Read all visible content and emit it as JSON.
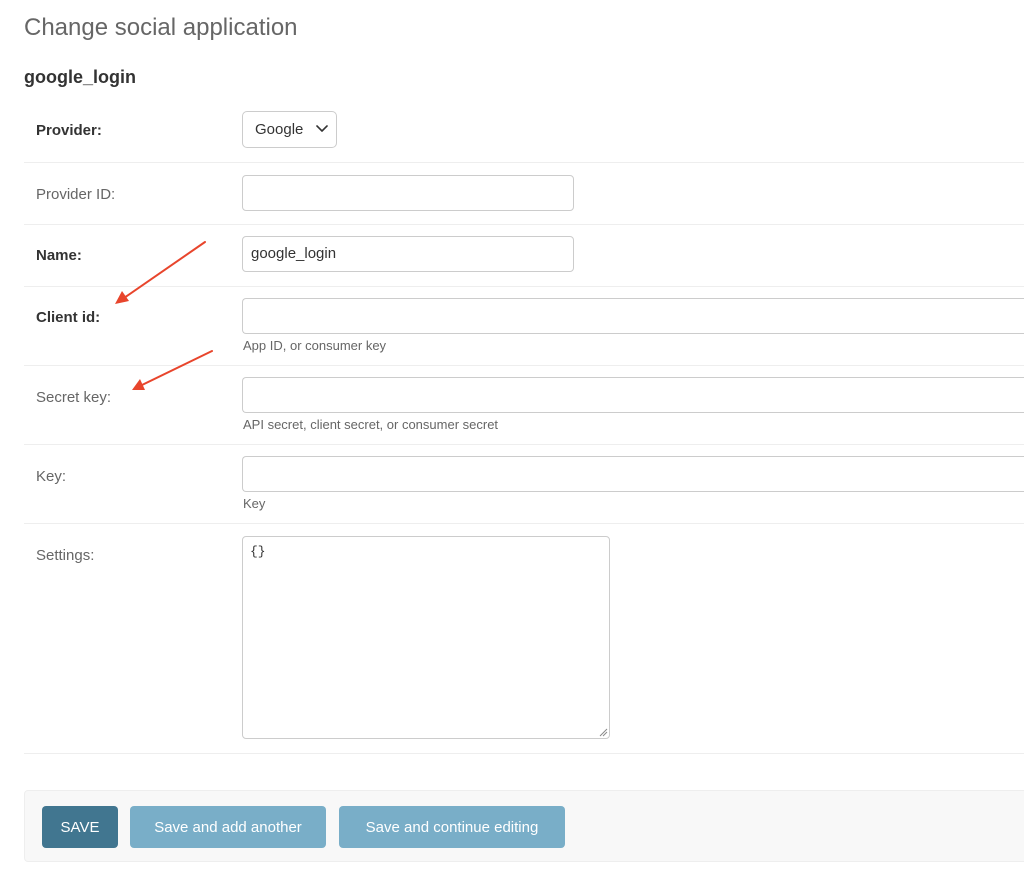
{
  "page": {
    "title": "Change social application",
    "object_name": "google_login"
  },
  "form": {
    "provider": {
      "label": "Provider:",
      "value": "Google"
    },
    "provider_id": {
      "label": "Provider ID:",
      "value": ""
    },
    "name": {
      "label": "Name:",
      "value": "google_login"
    },
    "client_id": {
      "label": "Client id:",
      "value": "",
      "help": "App ID, or consumer key"
    },
    "secret_key": {
      "label": "Secret key:",
      "value": "",
      "help": "API secret, client secret, or consumer secret"
    },
    "key": {
      "label": "Key:",
      "value": "",
      "help": "Key"
    },
    "settings": {
      "label": "Settings:",
      "value": "{}"
    }
  },
  "actions": {
    "save": "SAVE",
    "save_add_another": "Save and add another",
    "save_continue": "Save and continue editing"
  },
  "colors": {
    "primary_button": "#417690",
    "secondary_button": "#79aec8",
    "annotation_arrow": "#e8452c"
  },
  "icons": {
    "select_chevron": "chevron-down-icon",
    "textarea_grip": "resize-grip-icon",
    "annotations": "arrow-icon"
  }
}
